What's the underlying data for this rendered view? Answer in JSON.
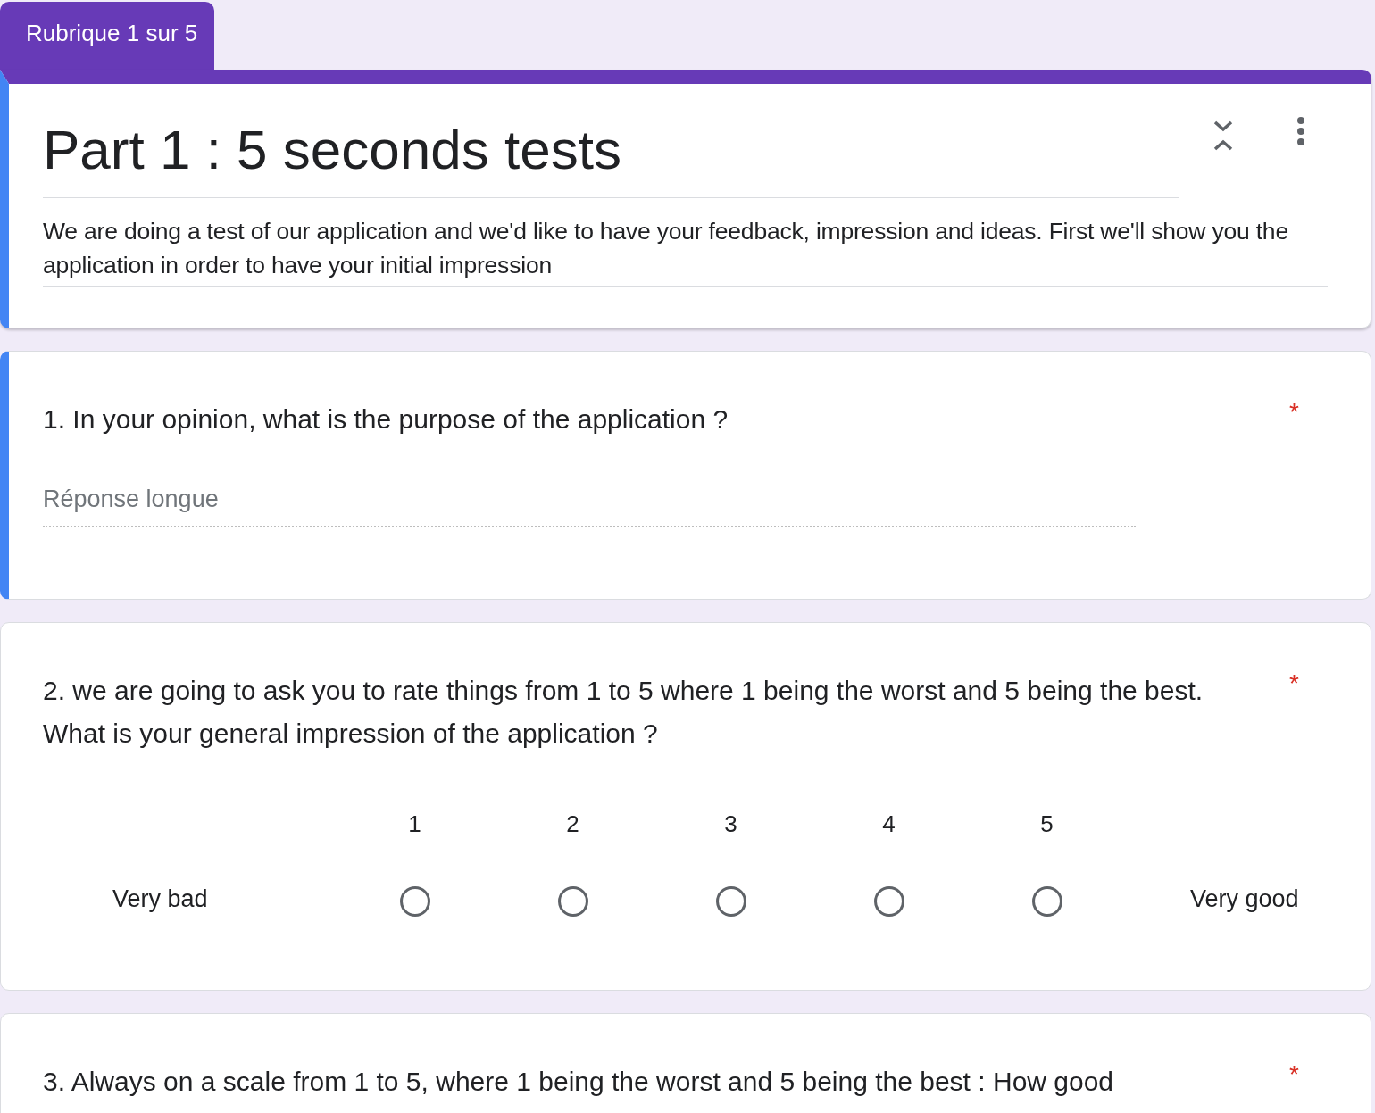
{
  "section_tab": {
    "label": "Rubrique 1 sur 5"
  },
  "header": {
    "title": "Part 1 : 5 seconds tests",
    "description": "We are doing a test of our application and we'd like to have your feedback, impression and ideas. First we'll show you the application in order to have your initial impression",
    "focused": true
  },
  "questions": [
    {
      "kind": "paragraph",
      "text": "1. In your opinion, what is the purpose of the application ?",
      "required": true,
      "required_mark": "*",
      "focused": true,
      "placeholder": "Réponse longue"
    },
    {
      "kind": "scale",
      "text": "2. we are going to ask you to rate things from 1 to 5 where 1 being the worst and 5 being the best. What is your general impression of the application ?",
      "required": true,
      "required_mark": "*",
      "focused": false,
      "min_label": "Very bad",
      "max_label": "Very good",
      "options": [
        {
          "label": "1",
          "selected": false
        },
        {
          "label": "2",
          "selected": false
        },
        {
          "label": "3",
          "selected": false
        },
        {
          "label": "4",
          "selected": false
        },
        {
          "label": "5",
          "selected": false
        }
      ]
    },
    {
      "kind": "heading",
      "text": "3. Always on a scale from 1 to 5, where 1 being the worst and 5 being the best : How good",
      "required": true,
      "required_mark": "*",
      "focused": false
    }
  ]
}
